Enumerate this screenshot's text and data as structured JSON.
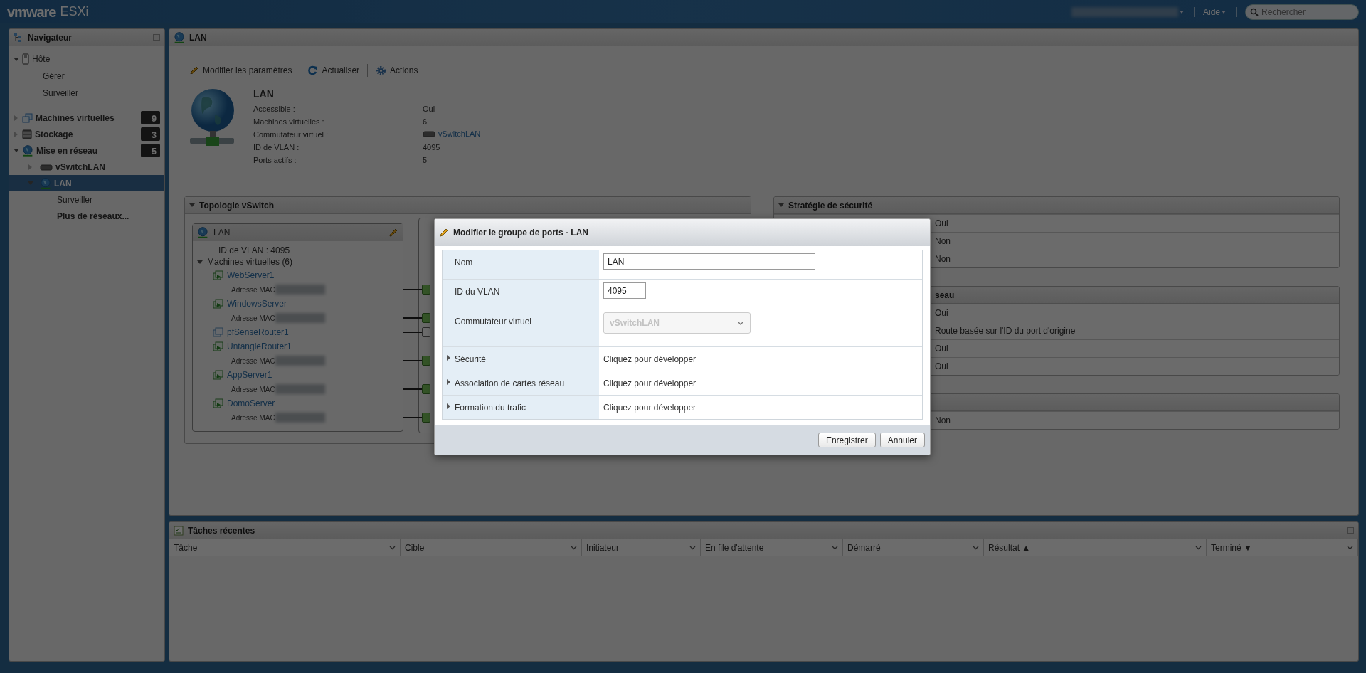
{
  "topbar": {
    "brand": "vmware",
    "product": "ESXi",
    "help": "Aide",
    "search_placeholder": "Rechercher"
  },
  "navigator": {
    "title": "Navigateur",
    "groups": [
      [
        {
          "label": "Hôte",
          "kind": "host",
          "expanded": true,
          "selected": false,
          "children": [
            {
              "label": "Gérer",
              "kind": "link",
              "selected": false
            },
            {
              "label": "Surveiller",
              "kind": "link",
              "selected": false
            }
          ]
        }
      ],
      [
        {
          "label": "Machines virtuelles",
          "kind": "vms",
          "expanded": false,
          "selected": false,
          "count": "9"
        },
        {
          "label": "Stockage",
          "kind": "storage",
          "expanded": false,
          "selected": false,
          "count": "3"
        },
        {
          "label": "Mise en réseau",
          "kind": "network",
          "expanded": true,
          "selected": false,
          "count": "5",
          "children": [
            {
              "label": "vSwitchLAN",
              "kind": "vswitch",
              "expanded": false,
              "selected": false
            },
            {
              "label": "LAN",
              "kind": "portgroup",
              "expanded": true,
              "selected": true,
              "children": [
                {
                  "label": "Surveiller",
                  "kind": "link",
                  "selected": false
                },
                {
                  "label": "Plus de réseaux...",
                  "kind": "more",
                  "selected": false
                }
              ]
            }
          ]
        }
      ]
    ]
  },
  "main": {
    "title": "LAN",
    "toolbar": [
      {
        "label": "Modifier les paramètres",
        "kind": "edit"
      },
      {
        "label": "Actualiser",
        "kind": "refresh"
      },
      {
        "label": "Actions",
        "kind": "gear"
      }
    ],
    "summary": {
      "title": "LAN",
      "rows": [
        {
          "label": "Accessible :",
          "value": "Oui"
        },
        {
          "label": "Machines virtuelles :",
          "value": "6"
        },
        {
          "label": "Commutateur virtuel :",
          "value": "vSwitchLAN",
          "kind": "link"
        },
        {
          "label": "ID de VLAN :",
          "value": "4095"
        },
        {
          "label": "Ports actifs :",
          "value": "5"
        }
      ]
    },
    "topology": {
      "title": "Topologie vSwitch",
      "portgroup": "LAN",
      "vlan": "ID de VLAN : 4095",
      "vm_header": "Machines virtuelles (6)",
      "vms": [
        {
          "name": "WebServer1",
          "powered_on": true,
          "mac_label": "Adresse MAC"
        },
        {
          "name": "WindowsServer",
          "powered_on": true,
          "mac_label": "Adresse MAC"
        },
        {
          "name": "pfSenseRouter1",
          "powered_on": false
        },
        {
          "name": "UntangleRouter1",
          "powered_on": true,
          "mac_label": "Adresse MAC"
        },
        {
          "name": "AppServer1",
          "powered_on": true,
          "mac_label": "Adresse MAC"
        },
        {
          "name": "DomoServer",
          "powered_on": true,
          "mac_label": "Adresse MAC"
        }
      ]
    },
    "side_panels": [
      {
        "title": "Stratégie de sécurité",
        "values": [
          "Oui",
          "Non",
          "Non"
        ]
      },
      {
        "title_tail": "seau",
        "values": [
          "Oui",
          "Route basée sur l'ID du port d'origine",
          "Oui",
          "Oui"
        ]
      },
      {
        "values": [
          "Non"
        ]
      }
    ]
  },
  "tasks": {
    "title": "Tâches récentes",
    "columns": [
      "Tâche",
      "Cible",
      "Initiateur",
      "En file d'attente",
      "Démarré",
      "Résultat ▲",
      "Terminé ▼"
    ]
  },
  "dialog": {
    "title": "Modifier le groupe de ports - LAN",
    "fields": [
      {
        "label": "Nom",
        "kind": "text",
        "value": "LAN"
      },
      {
        "label": "ID du VLAN",
        "kind": "number",
        "value": "4095"
      },
      {
        "label": "Commutateur virtuel",
        "kind": "select",
        "value": "vSwitchLAN",
        "disabled": true
      },
      {
        "label": "Sécurité",
        "kind": "expander",
        "expanded": false,
        "value": "Cliquez pour développer"
      },
      {
        "label": "Association de cartes réseau",
        "kind": "expander",
        "expanded": false,
        "value": "Cliquez pour développer"
      },
      {
        "label": "Formation du trafic",
        "kind": "expander",
        "expanded": false,
        "value": "Cliquez pour développer"
      }
    ],
    "buttons": [
      "Enregistrer",
      "Annuler"
    ]
  }
}
